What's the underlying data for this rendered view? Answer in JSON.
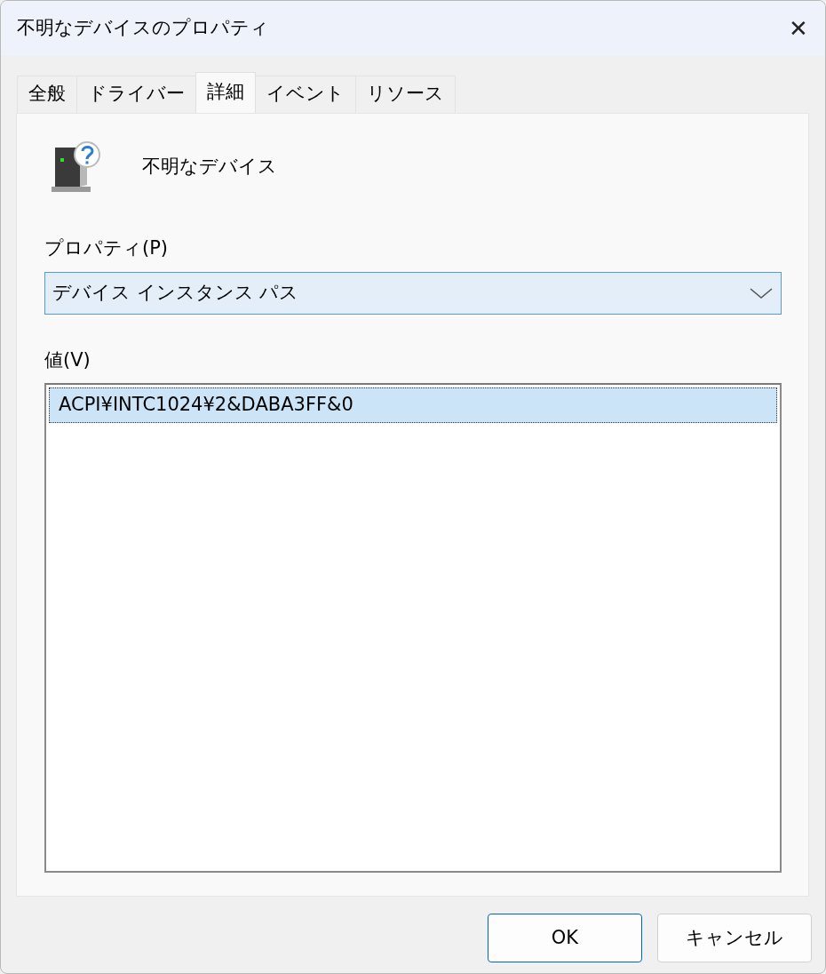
{
  "window": {
    "title": "不明なデバイスのプロパティ",
    "close": "✕"
  },
  "tabs": [
    {
      "label": "全般",
      "selected": false
    },
    {
      "label": "ドライバー",
      "selected": false
    },
    {
      "label": "詳細",
      "selected": true
    },
    {
      "label": "イベント",
      "selected": false
    },
    {
      "label": "リソース",
      "selected": false
    }
  ],
  "device": {
    "name": "不明なデバイス"
  },
  "property": {
    "label": "プロパティ(P)",
    "value": "デバイス インスタンス パス"
  },
  "values": {
    "label": "値(V)",
    "items": [
      {
        "text": "ACPI¥INTC1024¥2&DABA3FF&0",
        "selected": true
      }
    ]
  },
  "buttons": [
    {
      "label": "OK",
      "default": true
    },
    {
      "label": "キャンセル",
      "default": false
    }
  ]
}
